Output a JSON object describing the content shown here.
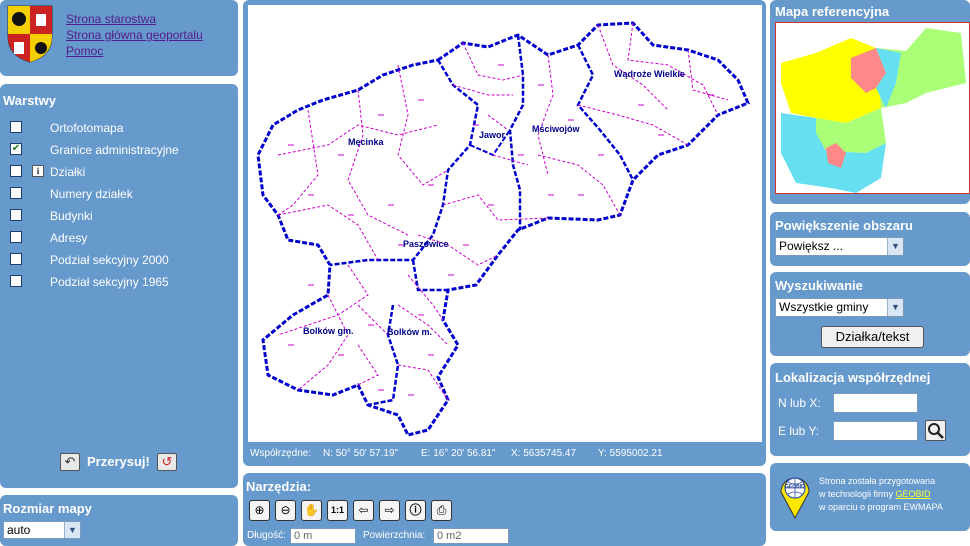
{
  "header": {
    "links": [
      "Strona starostwa",
      "Strona główna geoportalu",
      "Pomoc"
    ]
  },
  "layers": {
    "title": "Warstwy",
    "items": [
      {
        "label": "Ortofotomapa",
        "checked": false
      },
      {
        "label": "Granice administracyjne",
        "checked": true
      },
      {
        "label": "Działki",
        "checked": false
      },
      {
        "label": "Numery działek",
        "checked": false
      },
      {
        "label": "Budynki",
        "checked": false
      },
      {
        "label": "Adresy",
        "checked": false
      },
      {
        "label": "Podział sekcyjny 2000",
        "checked": false
      },
      {
        "label": "Podział sekcyjny 1965",
        "checked": false
      }
    ],
    "redraw_label": "Przerysuj!"
  },
  "map_size": {
    "title": "Rozmiar mapy",
    "value": "auto"
  },
  "map": {
    "places": [
      "Wądroże Wielkie",
      "Męcinka",
      "Jawor",
      "Mściwojów",
      "Paszowice",
      "Bolków gm.",
      "Bolków m."
    ],
    "coords": {
      "label": "Współrzędne:",
      "n": "N: 50° 50' 57.19\"",
      "e": "E: 16° 20' 56.81\"",
      "x": "X: 5635745.47",
      "y": "Y: 5595002.21"
    }
  },
  "tools": {
    "title": "Narzędzia:",
    "length_label": "Długość:",
    "length_value": "0 m",
    "area_label": "Powierzchnia:",
    "area_value": "0 m2"
  },
  "ref_map": {
    "title": "Mapa referencyjna"
  },
  "zoom": {
    "title": "Powiększenie obszaru",
    "value": "Powiększ ..."
  },
  "search": {
    "title": "Wyszukiwanie",
    "value": "Wszystkie gminy",
    "button": "Działka/tekst"
  },
  "locate": {
    "title": "Lokalizacja współrzędnej",
    "n_label": "N lub X:",
    "e_label": "E lub Y:"
  },
  "footer": {
    "line1": "Strona została przygotowana",
    "line2_pre": "w technologii firmy",
    "line2_link": "GEOBID",
    "line3": "w oparciu o program EWMAPA",
    "logo_text": "GEOBID"
  },
  "colors": {
    "panel": "#6699cc",
    "boundary": "#0000cc",
    "inner_boundary": "#cc00cc"
  }
}
